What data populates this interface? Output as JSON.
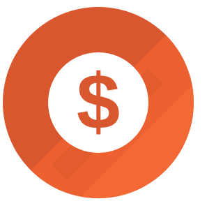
{
  "icon": {
    "name": "dollar-icon",
    "symbol": "$",
    "colors": {
      "base": "#D9572E",
      "light_band": "#F0622F",
      "lighter_band": "#F26A37",
      "shadow": "#C34E28",
      "inner_circle": "#FFFFFF",
      "symbol": "#D9572E"
    }
  }
}
